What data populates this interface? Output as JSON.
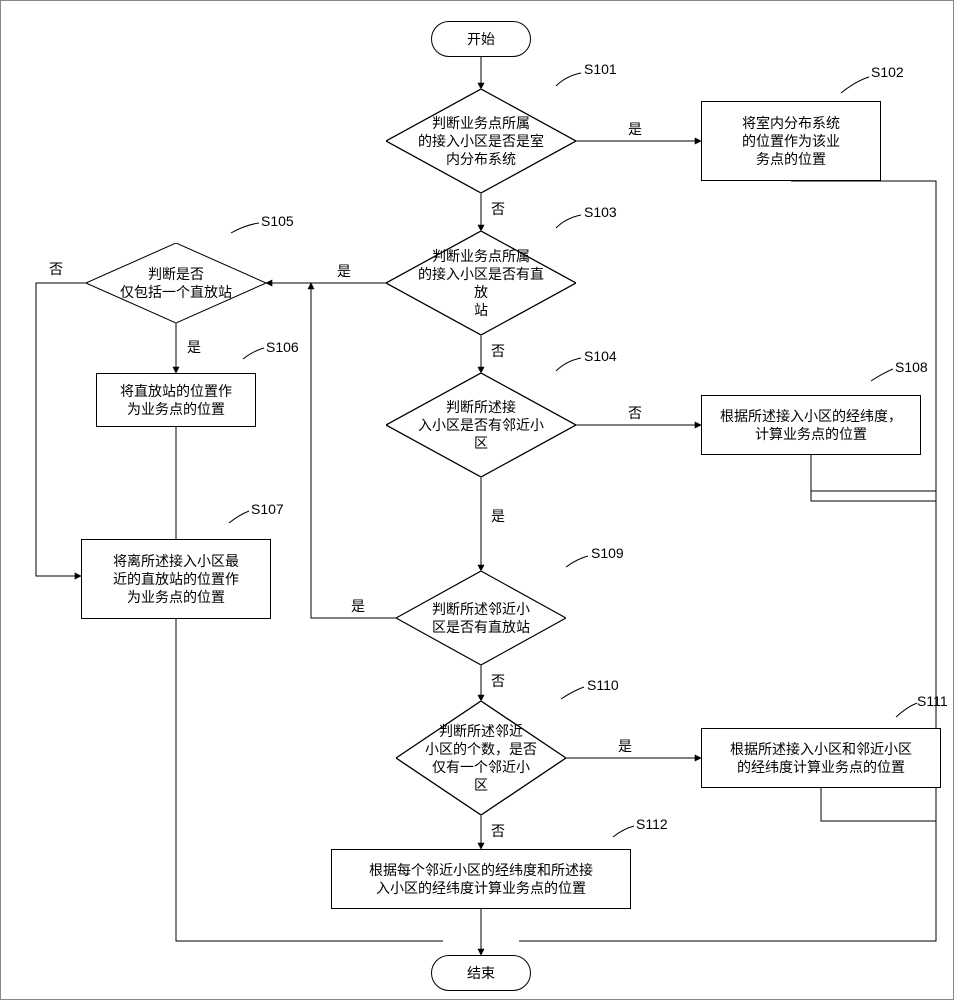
{
  "terminals": {
    "start": "开始",
    "end": "结束"
  },
  "decisions": {
    "s101": "判断业务点所属\n的接入小区是否是室\n内分布系统",
    "s103": "判断业务点所属\n的接入小区是否有直放\n站",
    "s104": "判断所述接\n入小区是否有邻近小区",
    "s105": "判断是否\n仅包括一个直放站",
    "s109": "判断所述邻近小\n区是否有直放站",
    "s110": "判断所述邻近\n小区的个数，是否\n仅有一个邻近小\n区"
  },
  "processes": {
    "s102": "将室内分布系统\n的位置作为该业\n务点的位置",
    "s106": "将直放站的位置作\n为业务点的位置",
    "s107": "将离所述接入小区最\n近的直放站的位置作\n为业务点的位置",
    "s108": "根据所述接入小区的经纬度，\n计算业务点的位置",
    "s111": "根据所述接入小区和邻近小区\n的经纬度计算业务点的位置",
    "s112": "根据每个邻近小区的经纬度和所述接\n入小区的经纬度计算业务点的位置"
  },
  "step_labels": {
    "s101": "S101",
    "s102": "S102",
    "s103": "S103",
    "s104": "S104",
    "s105": "S105",
    "s106": "S106",
    "s107": "S107",
    "s108": "S108",
    "s109": "S109",
    "s110": "S110",
    "s111": "S111",
    "s112": "S112"
  },
  "edge_labels": {
    "yes": "是",
    "no": "否"
  }
}
